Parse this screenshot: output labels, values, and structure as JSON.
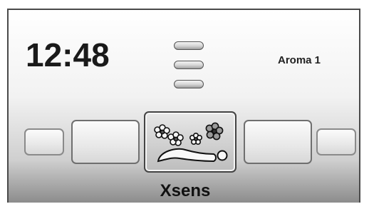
{
  "status": {
    "time": "12:48",
    "aroma": "Aroma 1"
  },
  "menu": {
    "icon": "hamburger-menu-icon"
  },
  "carousel": {
    "selected_label": "Xsens",
    "selected_icon": "flowers-reclining-person-icon",
    "items": [
      "",
      "",
      "Xsens",
      "",
      ""
    ]
  }
}
